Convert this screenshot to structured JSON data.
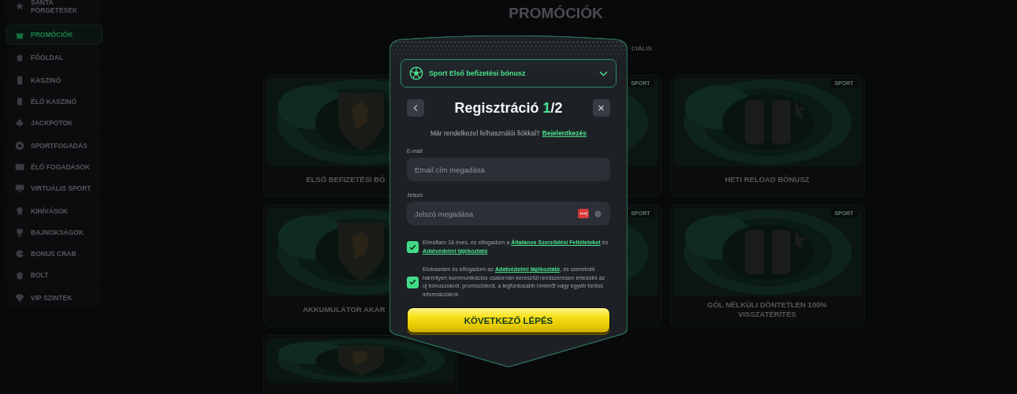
{
  "sidebar": {
    "groups": [
      {
        "items": [
          {
            "label": "SANTA PÖRGETÉSEK",
            "selected": false
          }
        ]
      },
      {
        "items": [
          {
            "label": "PROMÓCIÓK",
            "selected": true
          }
        ]
      },
      {
        "items": [
          {
            "label": "FŐOLDAL",
            "selected": false
          }
        ]
      },
      {
        "items": [
          {
            "label": "KASZINÓ",
            "selected": false
          },
          {
            "label": "ÉLŐ KASZINÓ",
            "selected": false
          },
          {
            "label": "JACKPOTOK",
            "selected": false
          }
        ]
      },
      {
        "items": [
          {
            "label": "SPORTFOGADÁS",
            "selected": false
          },
          {
            "label": "ÉLŐ FOGADÁSOK",
            "selected": false
          },
          {
            "label": "VIRTUÁLIS SPORT",
            "selected": false
          }
        ]
      },
      {
        "items": [
          {
            "label": "KIHÍVÁSOK",
            "selected": false
          },
          {
            "label": "BAJNOKSÁGOK",
            "selected": false
          },
          {
            "label": "BONUS CRAB",
            "selected": false
          },
          {
            "label": "BOLT",
            "selected": false
          }
        ]
      },
      {
        "items": [
          {
            "label": "VIP SZINTEK",
            "selected": false
          }
        ]
      }
    ]
  },
  "page": {
    "title": "PROMÓCIÓK",
    "filter_tab": "CIÁLIS"
  },
  "cards": [
    {
      "label": "ELSŐ BEFIZETÉSI BÓ"
    },
    {
      "badge": "SPORT"
    },
    {
      "badge": "SPORT",
      "label": "HETI RELOAD BÓNUSZ"
    },
    {
      "label": "AKKUMULÁTOR AKÁR"
    },
    {
      "badge": "SPORT"
    },
    {
      "badge": "SPORT",
      "label": "GÓL NÉLKÜLI DÖNTETLEN 100% VISSZATÉRÍTÉS"
    },
    {
      "kind": "picture"
    }
  ],
  "dialog": {
    "bonus_select": {
      "value": "Sport Első befizetési bónusz"
    },
    "title": {
      "text": "Regisztráció",
      "step": "1",
      "rest": "/2"
    },
    "login_prompt": {
      "text": "Már rendelkezel felhasználói fiókkal?",
      "link": "Bejelentkezés"
    },
    "fields": [
      {
        "label": "E-mail",
        "placeholder": "Email cím megadása",
        "kind": "text"
      },
      {
        "label": "Jelszó",
        "placeholder": "Jelszó megadása",
        "kind": "password"
      }
    ],
    "consents": [
      {
        "checked": true,
        "parts": [
          {
            "kind": "text",
            "text": "Elmúltam 18 éves, és elfogadom a "
          },
          {
            "kind": "link",
            "text": "Általános Szerződési Feltételeket"
          },
          {
            "kind": "text",
            "text": " és "
          },
          {
            "kind": "link",
            "text": "Adatvédelmi tájékoztató"
          }
        ]
      },
      {
        "checked": true,
        "parts": [
          {
            "kind": "text",
            "text": "Elolvastam és elfogadom az "
          },
          {
            "kind": "link",
            "text": "Adatvédelmi tájékoztató"
          },
          {
            "kind": "text",
            "text": ", és szeretnék bármilyen kommunikációs csatornán keresztül rendszeresen értesülni az új bónuszokról, promóciókról, a legfontosabb hírekről vagy egyéb fontos információkról."
          }
        ]
      }
    ],
    "submit": "KÖVETKEZŐ LÉPÉS"
  }
}
